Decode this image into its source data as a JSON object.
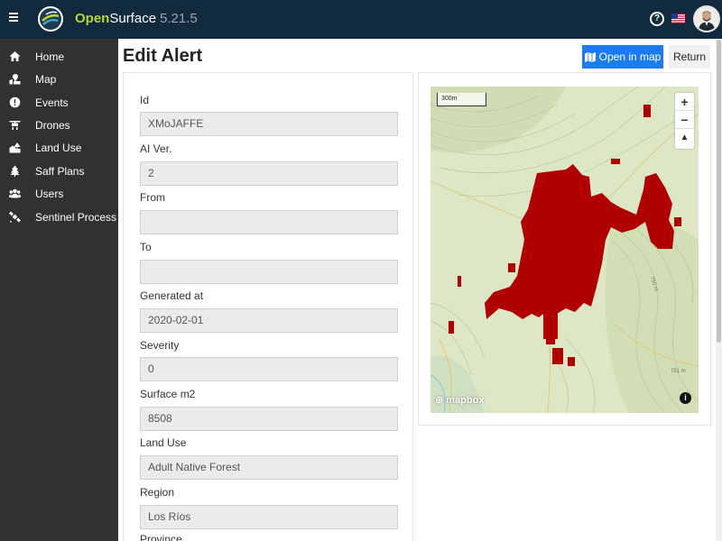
{
  "app": {
    "brand_part1": "Open",
    "brand_part2": "Surface",
    "version": "5.21.5"
  },
  "sidebar": {
    "items": [
      {
        "label": "Home",
        "icon": "home-icon"
      },
      {
        "label": "Map",
        "icon": "map-icon"
      },
      {
        "label": "Events",
        "icon": "alert-circle-icon"
      },
      {
        "label": "Drones",
        "icon": "drone-icon"
      },
      {
        "label": "Land Use",
        "icon": "land-use-icon"
      },
      {
        "label": "Saff Plans",
        "icon": "tree-icon"
      },
      {
        "label": "Users",
        "icon": "users-icon"
      },
      {
        "label": "Sentinel Process",
        "icon": "satellite-icon"
      }
    ]
  },
  "page": {
    "title": "Edit Alert",
    "open_map_label": "Open in map",
    "return_label": "Return"
  },
  "form": {
    "fields": [
      {
        "label": "Id",
        "value": "XMoJAFFE"
      },
      {
        "label": "AI Ver.",
        "value": "2"
      },
      {
        "label": "From",
        "value": ""
      },
      {
        "label": "To",
        "value": ""
      },
      {
        "label": "Generated at",
        "value": "2020-02-01"
      },
      {
        "label": "Severity",
        "value": "0"
      },
      {
        "label": "Surface m2",
        "value": "8508"
      },
      {
        "label": "Land Use",
        "value": "Adult Native Forest"
      },
      {
        "label": "Region",
        "value": "Los Ríos"
      },
      {
        "label": "Province",
        "value": ""
      }
    ]
  },
  "map": {
    "scale_label": "300m",
    "attribution": "mapbox",
    "contour_labels": [
      "750 m",
      "751 m"
    ],
    "zoom_in": "+",
    "zoom_out": "−",
    "reset_north": "▲",
    "alert_color": "#b00000"
  }
}
